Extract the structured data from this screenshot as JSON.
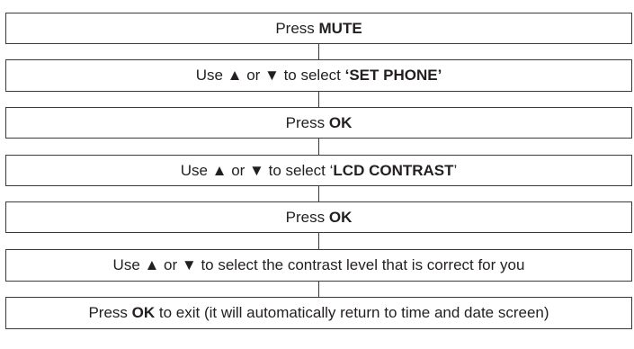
{
  "steps": [
    {
      "pre": "Press ",
      "bold": "MUTE",
      "post": ""
    },
    {
      "pre": "Use ▲ or ▼ to select ",
      "bold": "‘SET PHONE’",
      "post": ""
    },
    {
      "pre": "Press ",
      "bold": "OK",
      "post": ""
    },
    {
      "pre": "Use ▲ or ▼ to select ‘",
      "bold": "LCD CONTRAST",
      "post": "’"
    },
    {
      "pre": "Press ",
      "bold": "OK",
      "post": ""
    },
    {
      "pre": "Use ▲ or ▼ to select the contrast level that is correct for you",
      "bold": "",
      "post": ""
    },
    {
      "pre": "Press ",
      "bold": "OK",
      "post": " to exit (it will automatically return to time and date screen)"
    }
  ]
}
